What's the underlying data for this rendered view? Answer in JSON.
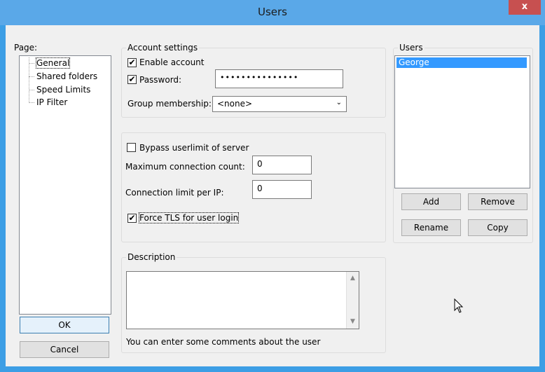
{
  "window": {
    "title": "Users",
    "close_glyph": "x"
  },
  "page_label": "Page:",
  "tree": {
    "items": [
      "General",
      "Shared folders",
      "Speed Limits",
      "IP Filter"
    ]
  },
  "account": {
    "title": "Account settings",
    "enable_label": "Enable account",
    "enable_checked": "✔",
    "password_label": "Password:",
    "password_checked": "✔",
    "password_value": "•••••••••••••••",
    "group_label": "Group membership:",
    "group_value": "<none>",
    "group_chevron": "⌄"
  },
  "limits": {
    "bypass_label": "Bypass userlimit of server",
    "max_label": "Maximum connection count:",
    "max_value": "0",
    "perip_label": "Connection limit per IP:",
    "perip_value": "0",
    "tls_label": "Force TLS for user login",
    "tls_checked": "✔"
  },
  "description": {
    "title": "Description",
    "hint": "You can enter some comments about the user",
    "scroll_up": "▲",
    "scroll_down": "▼"
  },
  "users": {
    "title": "Users",
    "list": [
      "George"
    ],
    "add_label": "Add",
    "remove_label": "Remove",
    "rename_label": "Rename",
    "copy_label": "Copy"
  },
  "buttons": {
    "ok_label": "OK",
    "cancel_label": "Cancel"
  }
}
